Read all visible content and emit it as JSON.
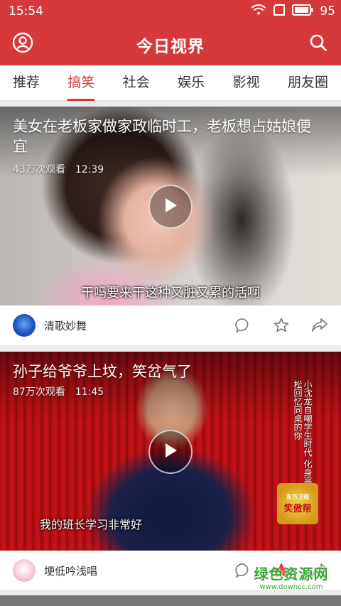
{
  "status_bar": {
    "time": "15:54",
    "battery": "95"
  },
  "header": {
    "title": "今日视界"
  },
  "tabs": [
    {
      "label": "推荐",
      "active": false
    },
    {
      "label": "搞笑",
      "active": true
    },
    {
      "label": "社会",
      "active": false
    },
    {
      "label": "娱乐",
      "active": false
    },
    {
      "label": "影视",
      "active": false
    },
    {
      "label": "朋友圈",
      "active": false
    }
  ],
  "feed": [
    {
      "title": "美女在老板家做家政临时工，老板想占姑娘便宜",
      "views": "43万次观看",
      "duration": "12:39",
      "subtitle": "干吗要来干这种又脏又累的活啊",
      "author": "清歌妙舞",
      "favorited": false
    },
    {
      "title": "孙子给爷爷上坟，笑岔气了",
      "views": "87万次观看",
      "duration": "11:45",
      "subtitle": "我的班长学习非常好",
      "vertical_caption": "小沈龙自嘲学生时代 化身高晓松回忆同桌的你",
      "show_logo": "笑傲帮",
      "show_logo_sub": "东方卫视",
      "author": "埂低吟浅唱",
      "favorited": true
    }
  ],
  "watermark": {
    "text": "绿色资源网",
    "url": "www.downcc.com"
  },
  "colors": {
    "brand": "#d6393a",
    "favorite": "#e33a32",
    "watermark": "#39a536"
  }
}
